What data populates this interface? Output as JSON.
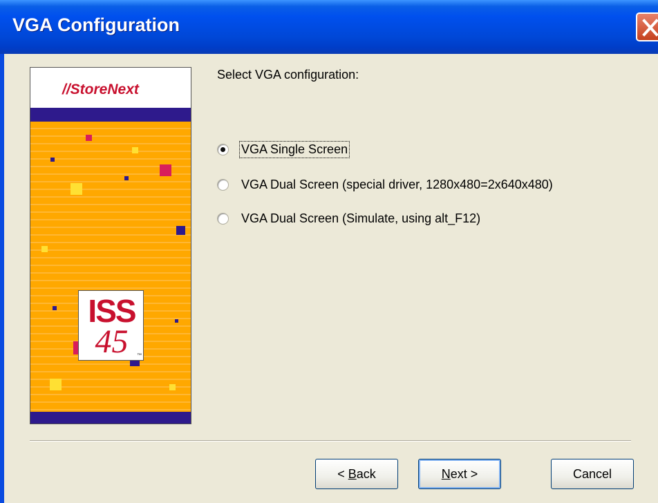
{
  "window": {
    "title": "VGA Configuration"
  },
  "side_panel": {
    "logo_text": "StoreNext",
    "product_line1": "ISS",
    "product_line2": "45",
    "trademark": "™"
  },
  "content": {
    "prompt": "Select VGA configuration:",
    "options": [
      {
        "label": "VGA Single Screen",
        "selected": true
      },
      {
        "label": "VGA Dual Screen (special driver, 1280x480=2x640x480)",
        "selected": false
      },
      {
        "label": "VGA Dual Screen (Simulate, using alt_F12)",
        "selected": false
      }
    ]
  },
  "buttons": {
    "back_prefix": "< ",
    "back_accel": "B",
    "back_rest": "ack",
    "next_accel": "N",
    "next_rest": "ext >",
    "cancel": "Cancel"
  },
  "colors": {
    "titlebar": "#0050EE",
    "panel_orange": "#FFA800",
    "panel_band": "#2E1A8C",
    "brand_red": "#C8102E"
  }
}
